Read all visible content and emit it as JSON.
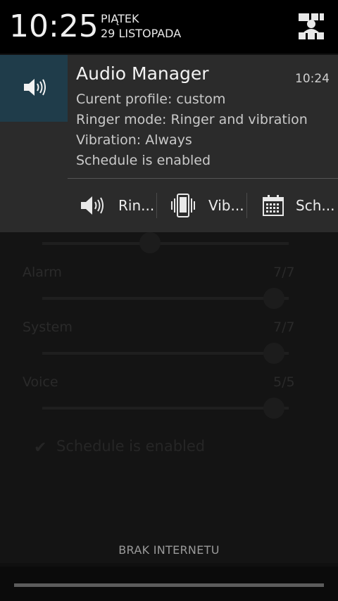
{
  "status": {
    "time": "10:25",
    "day": "PIĄTEK",
    "date": "29 LISTOPADA",
    "settings_icon": "quick-settings-icon"
  },
  "notification": {
    "app_icon": "speaker-icon",
    "title": "Audio Manager",
    "time": "10:24",
    "lines": [
      "Curent profile: custom",
      "Ringer mode: Ringer and vibration",
      "Vibration: Always",
      "Schedule is enabled"
    ],
    "actions": [
      {
        "icon": "speaker-icon",
        "label": "Rin..."
      },
      {
        "icon": "vibrate-icon",
        "label": "Vib..."
      },
      {
        "icon": "calendar-icon",
        "label": "Sch..."
      }
    ],
    "accent_color": "#1f3c4a"
  },
  "background_app": {
    "labels": [
      "Alarm",
      "System",
      "Voice"
    ],
    "values": [
      "7/7",
      "7/7",
      "5/5"
    ],
    "schedule_text": "Schedule is enabled"
  },
  "footer": {
    "carrier": "BRAK INTERNETU"
  }
}
